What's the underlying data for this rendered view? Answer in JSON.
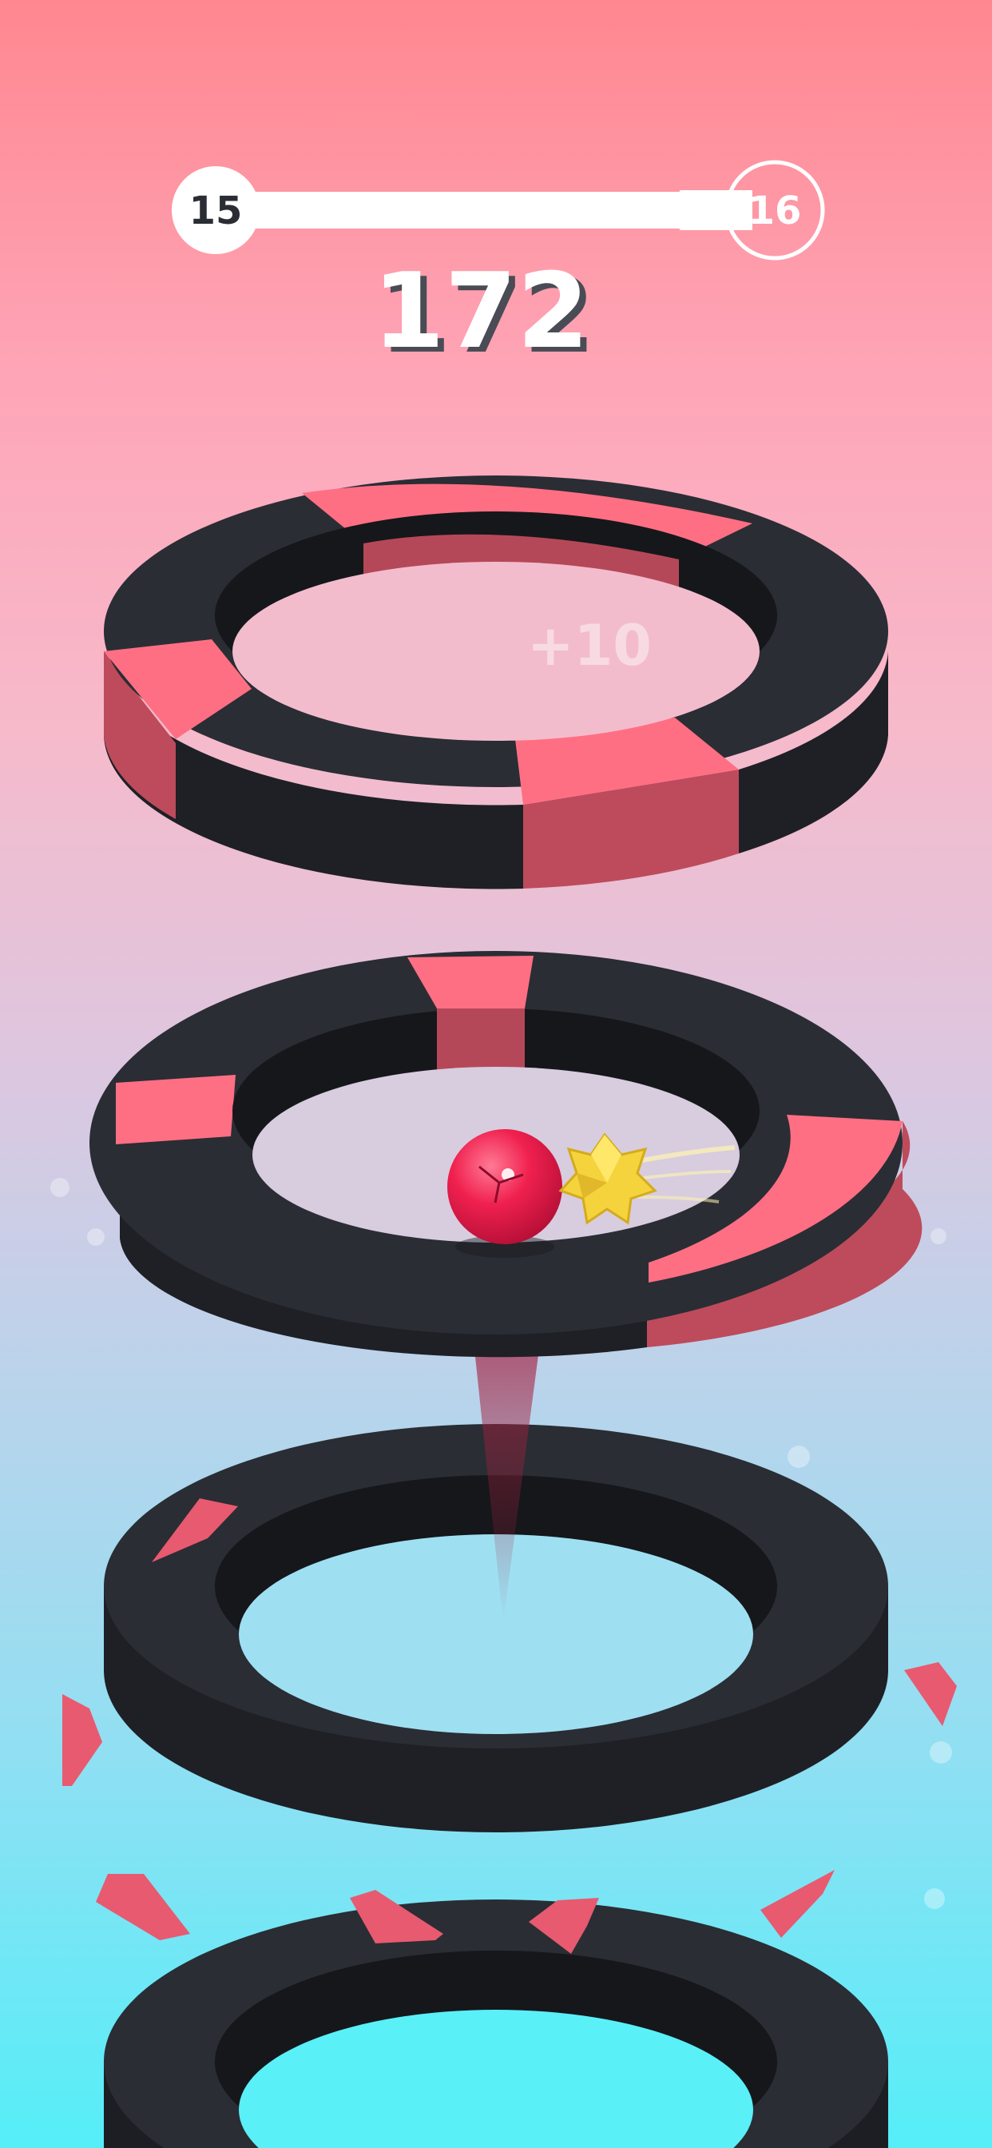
{
  "hud": {
    "current_level": "15",
    "next_level": "16",
    "level_progress": 0.87,
    "score": "172"
  },
  "popup": {
    "bonus_text": "+10"
  },
  "colors": {
    "safe_segment": "#2a2d34",
    "danger_segment": "#ff6f83",
    "ball": "#f0204e",
    "powerup": "#f5d33c",
    "sky_top": "#ff8790",
    "sky_bottom": "#55eef8"
  },
  "rings": [
    {
      "name": "ring-top",
      "segments": [
        "safe",
        "danger",
        "safe",
        "danger",
        "safe",
        "danger"
      ]
    },
    {
      "name": "ring-middle",
      "segments": [
        "safe",
        "danger",
        "safe",
        "danger",
        "safe"
      ]
    },
    {
      "name": "ring-lower",
      "segments": [
        "safe"
      ]
    },
    {
      "name": "ring-bottom",
      "segments": [
        "safe"
      ]
    }
  ],
  "icons": {
    "ball": "ball-icon",
    "powerup": "spiky-star-powerup-icon",
    "shard": "broken-shard-icon"
  }
}
